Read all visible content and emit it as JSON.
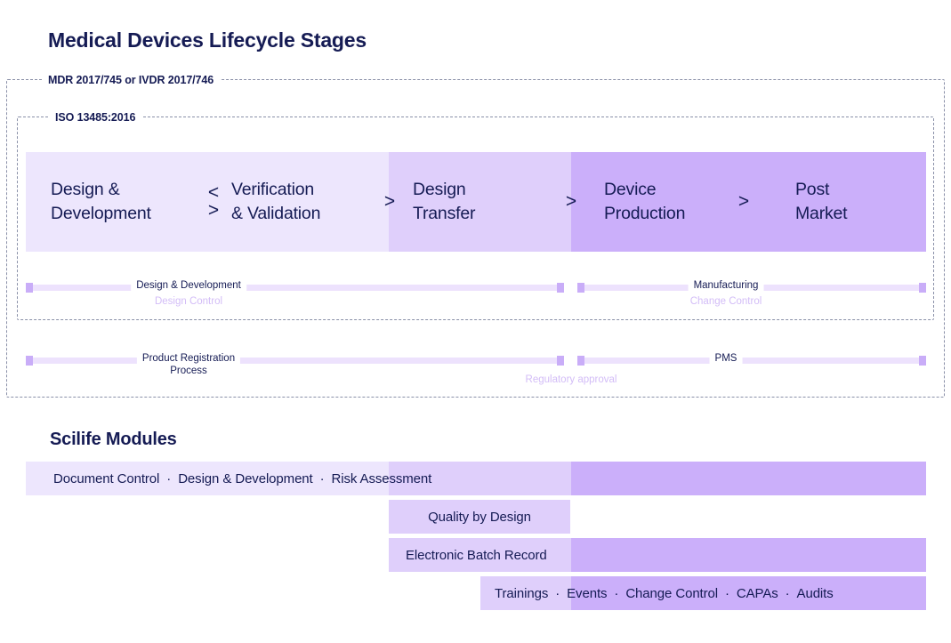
{
  "page_title": "Medical Devices Lifecycle Stages",
  "section_title": "Scilife Modules",
  "colors": {
    "text_navy": "#151B54",
    "shade_light": "#EDE6FD",
    "shade_medium": "#DFCFFB",
    "shade_dark": "#CBAFFA",
    "bar_track": "#EDE2FD",
    "bar_cap": "#C9ADF8",
    "sublabel_purple": "#D3BDF7",
    "dashed_border": "#8A90A8"
  },
  "frames": {
    "outer_label": "MDR 2017/745 or IVDR 2017/746",
    "inner_label": "ISO 13485:2016"
  },
  "stages": [
    {
      "label": "Design &\nDevelopment",
      "shade": "light"
    },
    {
      "label": "Verification\n& Validation",
      "shade": "light"
    },
    {
      "label": "Design\nTransfer",
      "shade": "medium"
    },
    {
      "label": "Device\nProduction",
      "shade": "dark"
    },
    {
      "label": "Post\nMarket",
      "shade": "dark"
    }
  ],
  "arrows": {
    "bidirectional_top": "<",
    "bidirectional_bottom": ">",
    "forward": ">"
  },
  "bar_rows": [
    {
      "bars": [
        {
          "label": "Design & Development",
          "sublabel": "Design Control"
        },
        {
          "label": "Manufacturing",
          "sublabel": "Change Control"
        }
      ]
    },
    {
      "bars": [
        {
          "label": "Product Registration\nProcess",
          "sublabel": ""
        },
        {
          "label": "PMS",
          "sublabel": ""
        }
      ],
      "junction_sublabel": "Regulatory approval"
    }
  ],
  "module_rows": [
    {
      "items": [
        "Document Control",
        "Design & Development",
        "Risk Assessment"
      ],
      "separator": "·"
    },
    {
      "items": [
        "Quality by Design"
      ],
      "separator": "·"
    },
    {
      "items": [
        "Electronic Batch Record"
      ],
      "separator": "·"
    },
    {
      "items": [
        "Trainings",
        "Events",
        "Change Control",
        "CAPAs",
        "Audits"
      ],
      "separator": "·"
    }
  ]
}
